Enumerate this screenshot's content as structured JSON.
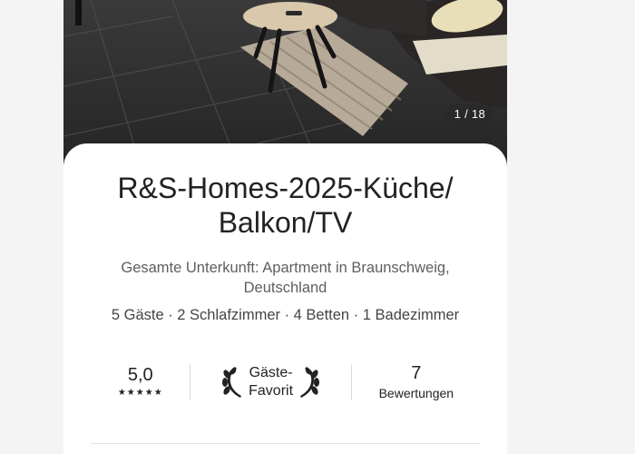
{
  "listing": {
    "photo_counter": "1 / 18",
    "title": "R&S-Homes-2025-Küche/ Balkon/TV",
    "subtitle": "Gesamte Unterkunft: Apartment in Braunschweig, Deutschland",
    "facts": "5 Gäste · 2 Schlafzimmer · 4 Betten · 1 Badezimmer"
  },
  "stats": {
    "rating": "5,0",
    "stars": "★★★★★",
    "favorite_line1": "Gäste-",
    "favorite_line2": "Favorit",
    "reviews_count": "7",
    "reviews_label": "Bewertungen"
  },
  "icons": {
    "left_laurel": "laurel-left-icon",
    "right_laurel": "laurel-right-icon"
  }
}
